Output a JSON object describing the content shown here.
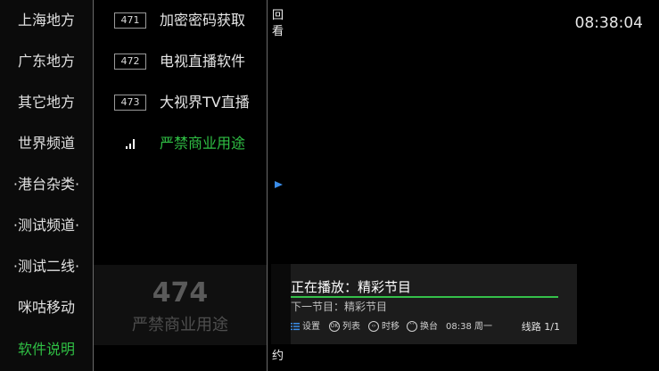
{
  "categories": [
    {
      "label": "上海地方"
    },
    {
      "label": "广东地方"
    },
    {
      "label": "其它地方"
    },
    {
      "label": "世界频道"
    },
    {
      "label": "·港台杂类·"
    },
    {
      "label": "·测试频道·"
    },
    {
      "label": "·测试二线·"
    },
    {
      "label": "咪咕移动"
    },
    {
      "label": "软件说明"
    }
  ],
  "active_category": "软件说明",
  "channels": [
    {
      "number": "471",
      "name": "加密密码获取"
    },
    {
      "number": "472",
      "name": "电视直播软件"
    },
    {
      "number": "473",
      "name": "大视界TV直播"
    },
    {
      "number": "",
      "name": "严禁商业用途",
      "icon": "signal-bars-icon"
    }
  ],
  "side_labels": {
    "replay": "回看",
    "reserve": "预约"
  },
  "clock": "08:38:04",
  "overlay": {
    "number": "474",
    "name": "严禁商业用途"
  },
  "now_playing": {
    "title": "正在播放：精彩节目",
    "next": "下一节目：精彩节目",
    "progress": 1.0
  },
  "hints": {
    "settings": "设置",
    "list": "列表",
    "timeshift": "时移",
    "switch": "换台",
    "datetime": "08:38 周一",
    "line": "线路 1/1"
  },
  "colors": {
    "active": "#2fbf44",
    "progress": "#34c04a",
    "arrow": "#3a8ce8"
  }
}
